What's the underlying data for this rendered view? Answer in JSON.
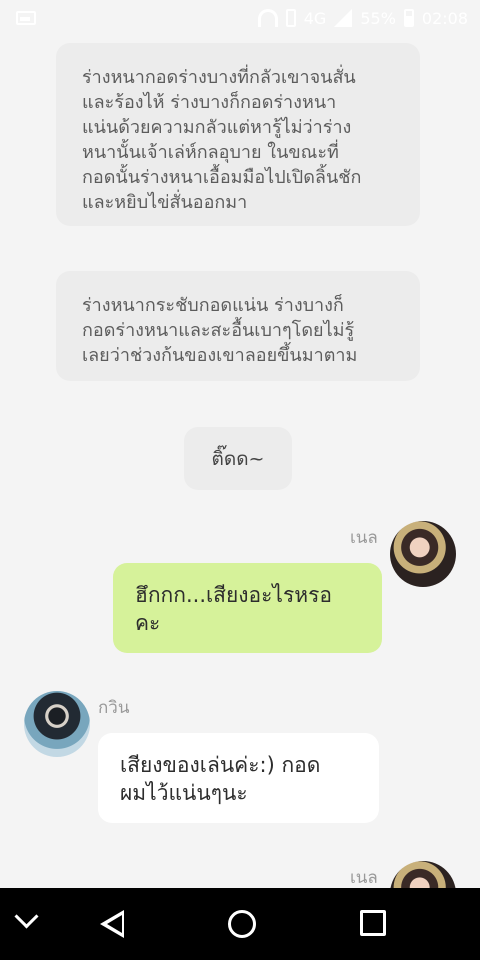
{
  "status_bar": {
    "network": "4G",
    "battery": "55%",
    "time": "02:08"
  },
  "narrations": [
    "ร่างหนากอดร่างบางที่กลัวเขาจนสั่น\nและร้องไห้ ร่างบางก็กอดร่างหนา\nแน่นด้วยความกลัวแต่หารู้ไม่ว่าร่าง\nหนานั้นเจ้าเล่ห์กลอุบาย ในขณะที่\nกอดนั้นร่างหนาเอื้อมมือไปเปิดลิ้นชัก\nและหยิบไข่สั่นออกมา",
    "ร่างหนากระชับกอดแน่น ร่างบางก็\nกอดร่างหนาและสะอื้นเบาๆโดยไม่รู้\nเลยว่าช่วงก้นของเขาลอยขึ้นมาตาม"
  ],
  "mini_bubble": "ติ๊ดด~",
  "messages": [
    {
      "sender": "เนล",
      "side": "right",
      "text": "ฮึกกก...เสียงอะไรหรอ\nคะ"
    },
    {
      "sender": "กวิน",
      "side": "left",
      "text": "เสียงของเล่นค่ะ:) กอด\nผมไว้แน่นๆนะ"
    },
    {
      "sender": "เนล",
      "side": "right",
      "text": ""
    }
  ],
  "colors": {
    "background": "#f4f4f4",
    "narration_bg": "#ececec",
    "green_bubble": "#d6f29a",
    "white_bubble": "#ffffff",
    "nav_bar": "#000000"
  },
  "nav_icons": [
    "chevron-down-icon",
    "back-icon",
    "home-icon",
    "recents-icon"
  ]
}
